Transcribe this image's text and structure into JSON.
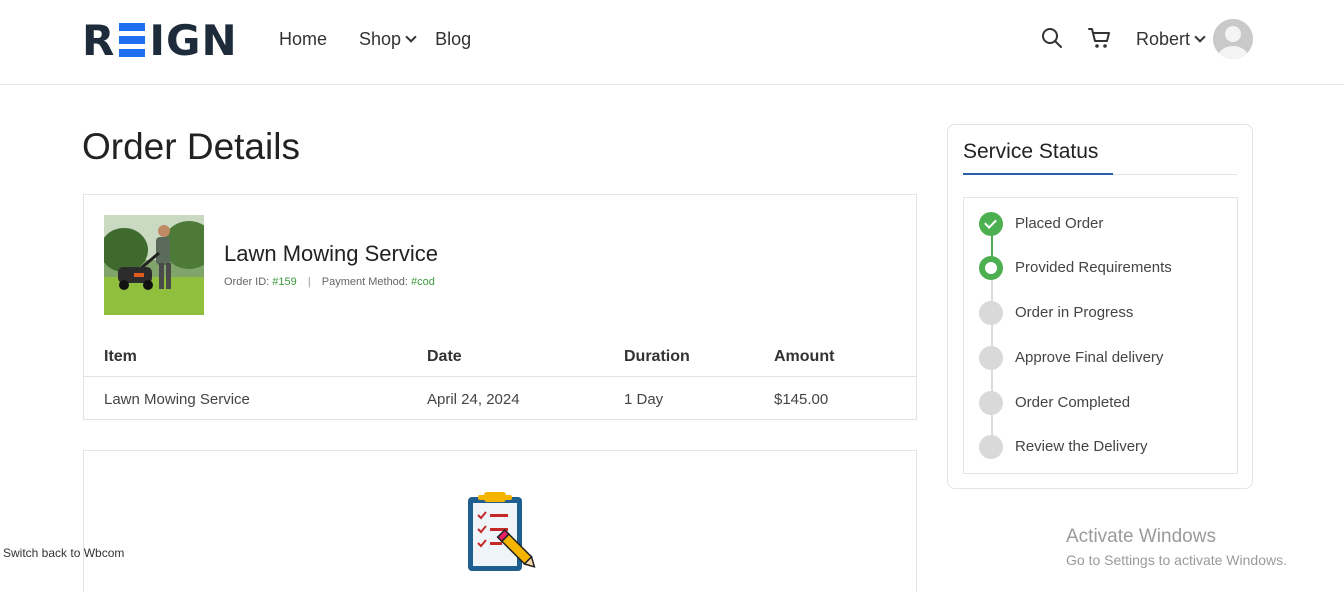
{
  "header": {
    "logo_text": "REIGN",
    "nav": [
      {
        "label": "Home"
      },
      {
        "label": "Shop"
      },
      {
        "label": "Blog"
      }
    ],
    "user_name": "Robert"
  },
  "page_title": "Order Details",
  "order": {
    "product_title": "Lawn Mowing Service",
    "order_id_label": "Order ID:",
    "order_id_value": "#159",
    "payment_label": "Payment Method:",
    "payment_value": "#cod",
    "table": {
      "headers": [
        "Item",
        "Date",
        "Duration",
        "Amount"
      ],
      "rows": [
        [
          "Lawn Mowing Service",
          "April 24, 2024",
          "1 Day",
          "$145.00"
        ]
      ]
    }
  },
  "status": {
    "title": "Service Status",
    "steps": [
      {
        "label": "Placed Order",
        "state": "done"
      },
      {
        "label": "Provided Requirements",
        "state": "current"
      },
      {
        "label": "Order in Progress",
        "state": "pending"
      },
      {
        "label": "Approve Final delivery",
        "state": "pending"
      },
      {
        "label": "Order Completed",
        "state": "pending"
      },
      {
        "label": "Review the Delivery",
        "state": "pending"
      }
    ]
  },
  "switch_back": "Switch back to Wbcom",
  "activate_windows": {
    "line1": "Activate Windows",
    "line2": "Go to Settings to activate Windows."
  },
  "colors": {
    "brand_blue": "#1f6ff0",
    "success_green": "#4caf50",
    "accent_underline": "#2b5ea7"
  }
}
